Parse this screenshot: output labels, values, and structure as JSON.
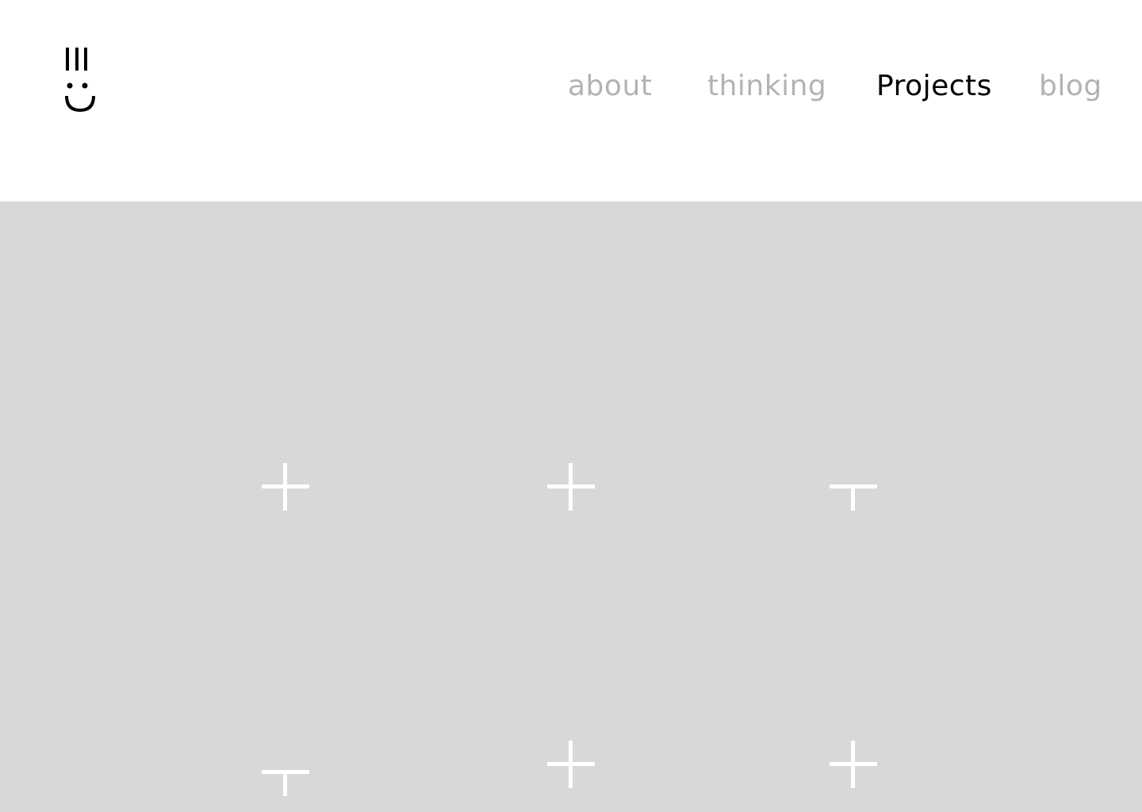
{
  "nav": {
    "items": [
      {
        "label": "about",
        "active": false
      },
      {
        "label": "thinking",
        "active": false
      },
      {
        "label": "Projects",
        "active": true
      },
      {
        "label": "blog",
        "active": false
      }
    ]
  },
  "colors": {
    "nav_inactive": "#b3b3b3",
    "nav_active": "#000000",
    "grid_background": "#d8d8d8",
    "marker": "#ffffff"
  },
  "grid": {
    "markers": [
      {
        "icon": "plus-icon"
      },
      {
        "icon": "plus-icon"
      },
      {
        "icon": "tee-icon"
      },
      {
        "icon": "tee-icon"
      },
      {
        "icon": "plus-icon"
      },
      {
        "icon": "plus-icon"
      }
    ]
  }
}
